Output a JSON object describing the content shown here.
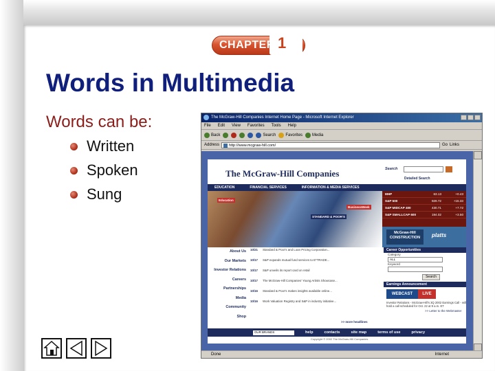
{
  "slide": {
    "chapter_label": "CHAPTER",
    "chapter_number": "1",
    "title": "Words in Multimedia",
    "lead": "Words can be:",
    "bullets": [
      "Written",
      "Spoken",
      "Sung"
    ]
  },
  "nav_buttons": {
    "home": "home-icon",
    "previous": "triangle-left-icon",
    "next": "triangle-right-icon"
  },
  "browser": {
    "title": "The McGraw-Hill Companies Internet Home Page - Microsoft Internet Explorer",
    "menu": [
      "File",
      "Edit",
      "View",
      "Favorites",
      "Tools",
      "Help"
    ],
    "toolbar": [
      "Back",
      "Search",
      "Favorites",
      "Media"
    ],
    "address_label": "Address",
    "address": "http://www.mcgraw-hill.com/",
    "go_label": "Go",
    "links_label": "Links",
    "status_left": "Done",
    "status_right": "Internet"
  },
  "site": {
    "logo": "The McGraw-Hill Companies",
    "search_label": "Search",
    "detailed_search": "Detailed Search",
    "nav": [
      "EDUCATION",
      "FINANCIAL SERVICES",
      "INFORMATION & MEDIA SERVICES"
    ],
    "hero_tags": [
      "Education",
      "BusinessWeek",
      "STANDARD & POOR'S"
    ],
    "ticker": [
      {
        "name": "MHP",
        "value": "63.13",
        "change": "+0.43"
      },
      {
        "name": "S&P 500",
        "value": "929.72",
        "change": "+15.33"
      },
      {
        "name": "S&P MIDCAP 400",
        "value": "430.71",
        "change": "+7.72"
      },
      {
        "name": "S&P SMALLCAP 600",
        "value": "194.02",
        "change": "+3.50"
      }
    ],
    "promo_left": "McGraw-Hill CONSTRUCTION",
    "promo_right": "platts",
    "sidebar": [
      "About Us",
      "Our Markets",
      "Investor Relations",
      "Careers",
      "Partnerships",
      "Media",
      "Community",
      "Shop"
    ],
    "news": [
      {
        "date": "10/21",
        "text": "Standard & Poor's and Loan Pricing Corporation..."
      },
      {
        "date": "10/17",
        "text": "S&P expands mutual fund services to E*TRADE..."
      },
      {
        "date": "10/17",
        "text": "S&P unveils its report card on retail"
      },
      {
        "date": "10/17",
        "text": "The McGraw-Hill Companies' Young Artists Showcase..."
      },
      {
        "date": "10/16",
        "text": "Standard & Poor's makes insights available online..."
      },
      {
        "date": "10/16",
        "text": "Work Valuation Registry and S&P in industry initiative..."
      }
    ],
    "news_more": ">> more headlines",
    "careers_head": "Career Opportunities",
    "category_label": "Category",
    "category_value": "ALL",
    "keyword_label": "Keyword",
    "search_button": "Search",
    "earnings_head": "Earnings Announcement",
    "webcast_a": "WEBCAST",
    "webcast_b": "LIVE",
    "webcast_note": "Investor Relations - McGraw-Hill's 3Q 2002 Earnings Call - will hold a call scheduled for Oct. 22 at 9 a.m. ET",
    "letter_link": ">> Letter to the Webmaster",
    "footer_select": "OUR BRANDS",
    "footer_links": [
      "help",
      "contacts",
      "site map",
      "terms of use",
      "privacy"
    ],
    "copyright": "Copyright © 2002 The McGraw-Hill Companies"
  },
  "colors": {
    "title": "#101f7c",
    "lead": "#8b1d1a",
    "chapter_badge": "#c9421e"
  }
}
